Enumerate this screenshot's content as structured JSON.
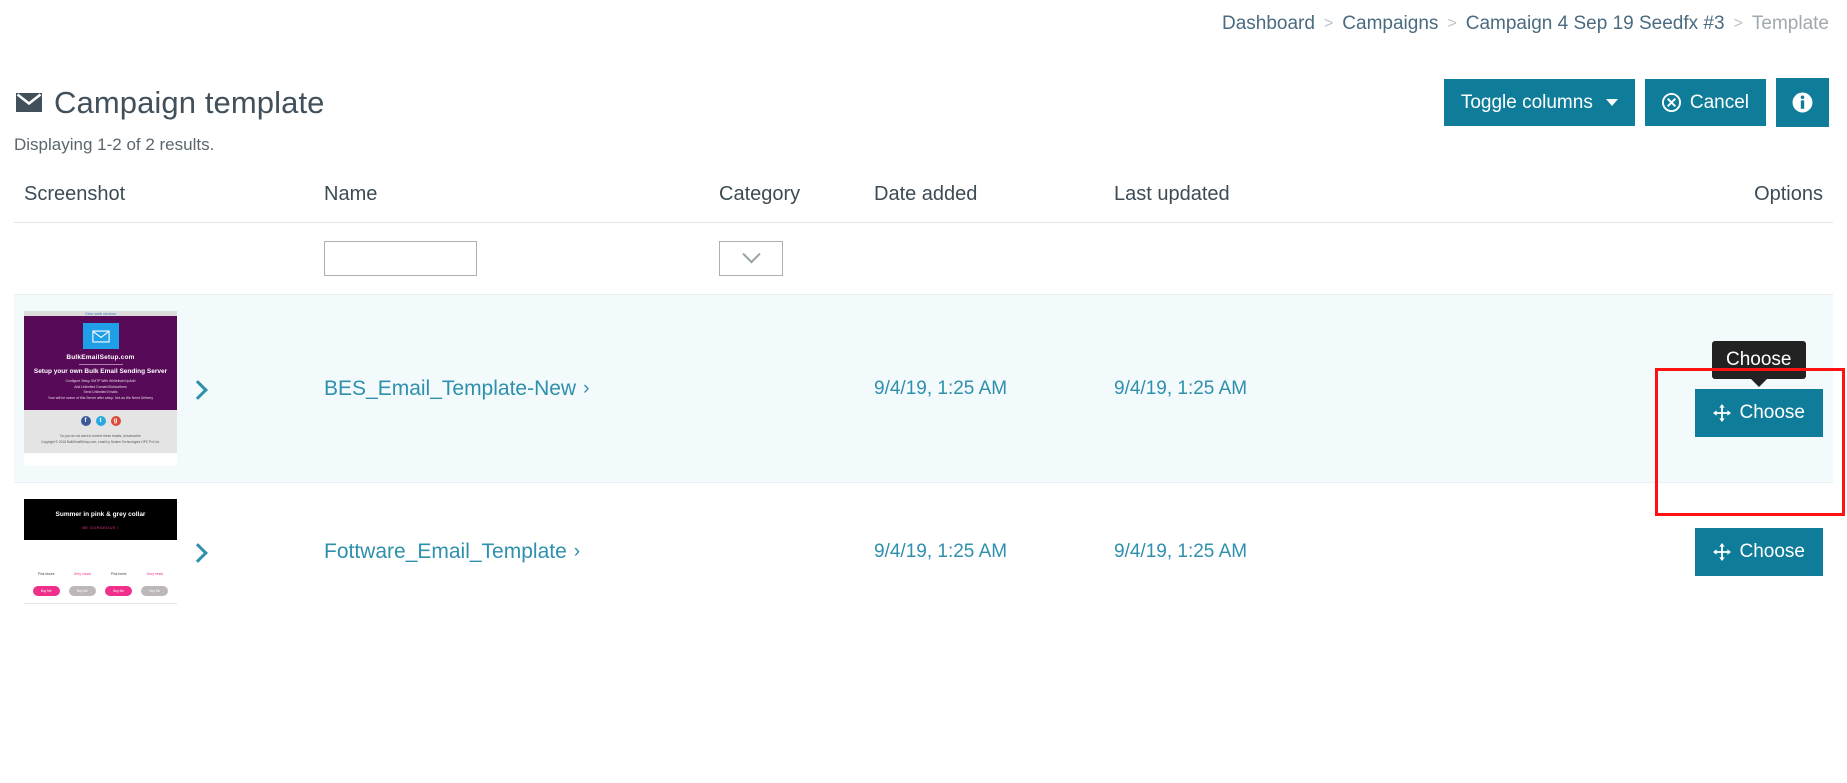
{
  "breadcrumb": {
    "items": [
      {
        "label": "Dashboard",
        "current": false
      },
      {
        "label": "Campaigns",
        "current": false
      },
      {
        "label": "Campaign 4 Sep 19 Seedfx #3",
        "current": false
      },
      {
        "label": "Template",
        "current": true
      }
    ],
    "separator": ">"
  },
  "header": {
    "title": "Campaign template",
    "title_icon": "envelope-icon",
    "toggle_columns_label": "Toggle columns",
    "cancel_label": "Cancel",
    "cancel_icon": "cancel-circle-icon",
    "info_icon": "info-circle-icon",
    "accent_color": "#0f7c99"
  },
  "results_count": "Displaying 1-2 of 2 results.",
  "table": {
    "columns": [
      {
        "key": "screenshot",
        "label": "Screenshot"
      },
      {
        "key": "name",
        "label": "Name"
      },
      {
        "key": "category",
        "label": "Category"
      },
      {
        "key": "date_added",
        "label": "Date added"
      },
      {
        "key": "last_updated",
        "label": "Last updated"
      },
      {
        "key": "options",
        "label": "Options"
      }
    ],
    "filters": {
      "name_value": "",
      "name_placeholder": "",
      "category_value": "",
      "category_icon": "chevron-down-icon"
    },
    "rows": [
      {
        "name": "BES_Email_Template-New",
        "name_arrow": "›",
        "category": "",
        "date_added": "9/4/19, 1:25 AM",
        "last_updated": "9/4/19, 1:25 AM",
        "choose_label": "Choose",
        "choose_icon": "move-arrows-icon",
        "tooltip": "Choose",
        "highlighted": true,
        "thumbnail": {
          "preheader": "View web version",
          "brand": "BulkEmailSetup.com",
          "headline": "Setup your own Bulk Email Sending Server",
          "bullets": [
            "Configure Setup SMTP With Whitelisted IpAdd",
            "Add Unlimited Domain/Subscribers",
            "Send Unlimited Emails",
            "Your will be owner of this Server after setup. Not as We Need Delivery"
          ],
          "social": [
            "f",
            "t",
            "g"
          ],
          "footer_line": "Do you do not want to receive these emails, Unsubscribe",
          "copyright": "Copyright © 2018 BulkEmailSetup.com, email by Sedem Technologies OPC Pvt Ltd."
        }
      },
      {
        "name": "Fottware_Email_Template",
        "name_arrow": "›",
        "category": "",
        "date_added": "9/4/19, 1:25 AM",
        "last_updated": "9/4/19, 1:25 AM",
        "choose_label": "Choose",
        "choose_icon": "move-arrows-icon",
        "tooltip": null,
        "highlighted": false,
        "thumbnail": {
          "title": "Summer in pink & grey collar",
          "subtitle": "BE GORGEOUS !",
          "products": [
            {
              "caption": "Pink shoes",
              "button": "Buy Me",
              "style": "pink"
            },
            {
              "caption": "Grey shoes",
              "button": "Buy Me",
              "style": "grey"
            },
            {
              "caption": "Pink heels",
              "button": "Buy Me",
              "style": "pink"
            },
            {
              "caption": "Grey heels",
              "button": "Buy Me",
              "style": "grey"
            }
          ]
        }
      }
    ]
  },
  "highlight_box": {
    "color": "#ff1111"
  }
}
